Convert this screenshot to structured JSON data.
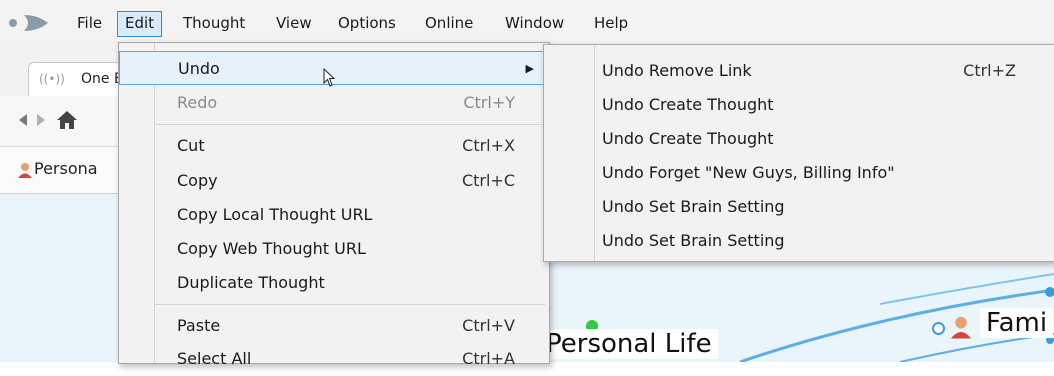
{
  "menubar": {
    "items": [
      "File",
      "Edit",
      "Thought",
      "View",
      "Options",
      "Online",
      "Window",
      "Help"
    ]
  },
  "tab": {
    "label": "One B"
  },
  "breadcrumb": {
    "label": "Persona"
  },
  "canvas": {
    "node_personal": "Personal Life",
    "node_family": "Fami"
  },
  "edit_menu": {
    "items": [
      {
        "label": "Undo",
        "shortcut": ""
      },
      {
        "label": "Redo",
        "shortcut": "Ctrl+Y"
      },
      {
        "label": "Cut",
        "shortcut": "Ctrl+X"
      },
      {
        "label": "Copy",
        "shortcut": "Ctrl+C"
      },
      {
        "label": "Copy Local Thought URL",
        "shortcut": ""
      },
      {
        "label": "Copy Web Thought URL",
        "shortcut": ""
      },
      {
        "label": "Duplicate Thought",
        "shortcut": ""
      },
      {
        "label": "Paste",
        "shortcut": "Ctrl+V"
      },
      {
        "label": "Select All",
        "shortcut": "Ctrl+A"
      }
    ]
  },
  "undo_submenu": {
    "items": [
      {
        "label": "Undo Remove Link",
        "shortcut": "Ctrl+Z"
      },
      {
        "label": "Undo Create Thought"
      },
      {
        "label": "Undo Create Thought"
      },
      {
        "label": "Undo Forget \"New Guys, Billing Info\""
      },
      {
        "label": "Undo Set Brain Setting"
      },
      {
        "label": "Undo Set Brain Setting"
      }
    ]
  },
  "colors": {
    "accent": "#2f8cd6",
    "canvas": "#eaf4fb",
    "node_dot": "#2ecc40"
  }
}
